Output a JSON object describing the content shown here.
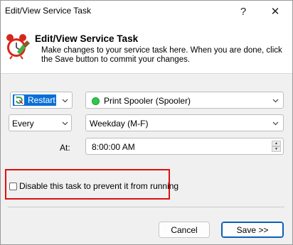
{
  "window": {
    "title": "Edit/View Service Task",
    "help_glyph": "?",
    "close_glyph": "✕"
  },
  "header": {
    "title": "Edit/View Service Task",
    "description": "Make changes to your service task here. When you are done, click the Save button to commit your changes.",
    "icon": "alarm-clock-icon"
  },
  "form": {
    "action": {
      "selected": "Restart",
      "icon": "restart-icon",
      "highlight_color": "#0a6fd6"
    },
    "service": {
      "selected": "Print Spooler (Spooler)",
      "status_color": "#2dc94b"
    },
    "frequency": {
      "selected": "Every"
    },
    "day_pattern": {
      "selected": "Weekday (M-F)"
    },
    "at_label": "At:",
    "time": {
      "value": "8:00:00 AM"
    },
    "disable_checkbox": {
      "label": "Disable this task to prevent it from running",
      "checked": false,
      "highlight_color": "#e10e0e"
    }
  },
  "buttons": {
    "cancel_label": "Cancel",
    "save_label": "Save >>"
  }
}
